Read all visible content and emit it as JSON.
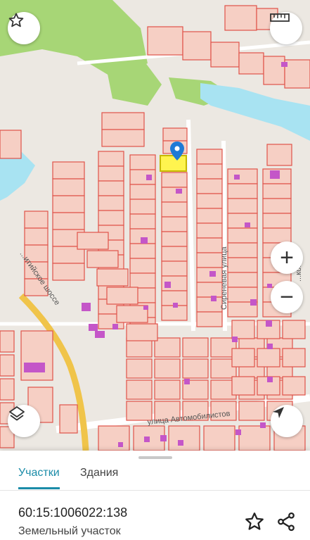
{
  "map": {
    "streets": {
      "sirenevaya": "Сиреневая улица",
      "avtomobilistov": "улица Автомобилистов",
      "shosse": "...итийское шоссе",
      "right_edge": "...кова"
    },
    "zoom_in": "+",
    "zoom_out": "−",
    "icons": {
      "favorite": "star-outline-icon",
      "ruler": "ruler-icon",
      "layers": "layers-icon",
      "locate": "navigation-arrow-icon",
      "pin": "location-pin-icon"
    },
    "colors": {
      "parcel_fill": "#f6cfc4",
      "parcel_border": "#e0534a",
      "building": "#c456c8",
      "green": "#a7d676",
      "water": "#a8e3f2",
      "selected_fill": "#fff44f",
      "selected_border": "#c7b800",
      "pin": "#1e7ad6",
      "highway": "#f0c44a"
    }
  },
  "sheet": {
    "tabs": [
      {
        "label": "Участки",
        "active": true
      },
      {
        "label": "Здания",
        "active": false
      }
    ],
    "parcel": {
      "cadastral_number": "60:15:1006022:138",
      "type": "Земельный участок"
    },
    "actions": {
      "favorite": "star-outline-icon",
      "share": "share-icon"
    },
    "accent": "#1b8ca8"
  }
}
